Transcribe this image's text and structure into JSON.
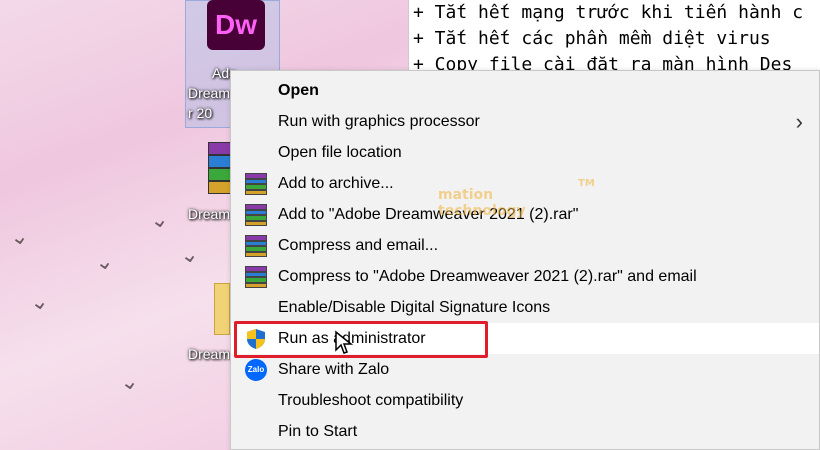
{
  "desktop": {
    "dw_logo_text": "Dw",
    "dw_label_lines": [
      "Ado",
      "Dream",
      "r 20"
    ],
    "rar_label": "Dream",
    "folder_label": "Dream"
  },
  "textfile": {
    "lines": [
      "+ Tắt hết mạng trước khi tiến hành c",
      "+ Tắt hết các phần mềm diệt virus",
      "+ Copy file cài đặt ra màn hình Des"
    ]
  },
  "watermark": {
    "brand_mark": "TM",
    "text": "mation technology"
  },
  "context_menu": {
    "items": [
      {
        "label": "Open",
        "icon": "none",
        "bold": true
      },
      {
        "label": "Run with graphics processor",
        "icon": "none",
        "submenu": true
      },
      {
        "label": "Open file location",
        "icon": "none"
      },
      {
        "label": "Add to archive...",
        "icon": "winrar-icon"
      },
      {
        "label": "Add to \"Adobe Dreamweaver 2021 (2).rar\"",
        "icon": "winrar-icon"
      },
      {
        "label": "Compress and email...",
        "icon": "winrar-icon"
      },
      {
        "label": "Compress to \"Adobe Dreamweaver 2021 (2).rar\" and email",
        "icon": "winrar-icon"
      },
      {
        "label": "Enable/Disable Digital Signature Icons",
        "icon": "none"
      },
      {
        "label": "Run as administrator",
        "icon": "uac-shield-icon",
        "highlighted": true
      },
      {
        "label": "Share with Zalo",
        "icon": "zalo-icon"
      },
      {
        "label": "Troubleshoot compatibility",
        "icon": "none"
      },
      {
        "label": "Pin to Start",
        "icon": "none"
      }
    ],
    "submenu_arrow": "›",
    "zalo_icon_text": "Zalo"
  },
  "colors": {
    "highlight_box": "#e01e2b",
    "menu_bg": "#f2f2f2",
    "dw_brand": "#ff61f6",
    "dw_bg": "#470137"
  }
}
